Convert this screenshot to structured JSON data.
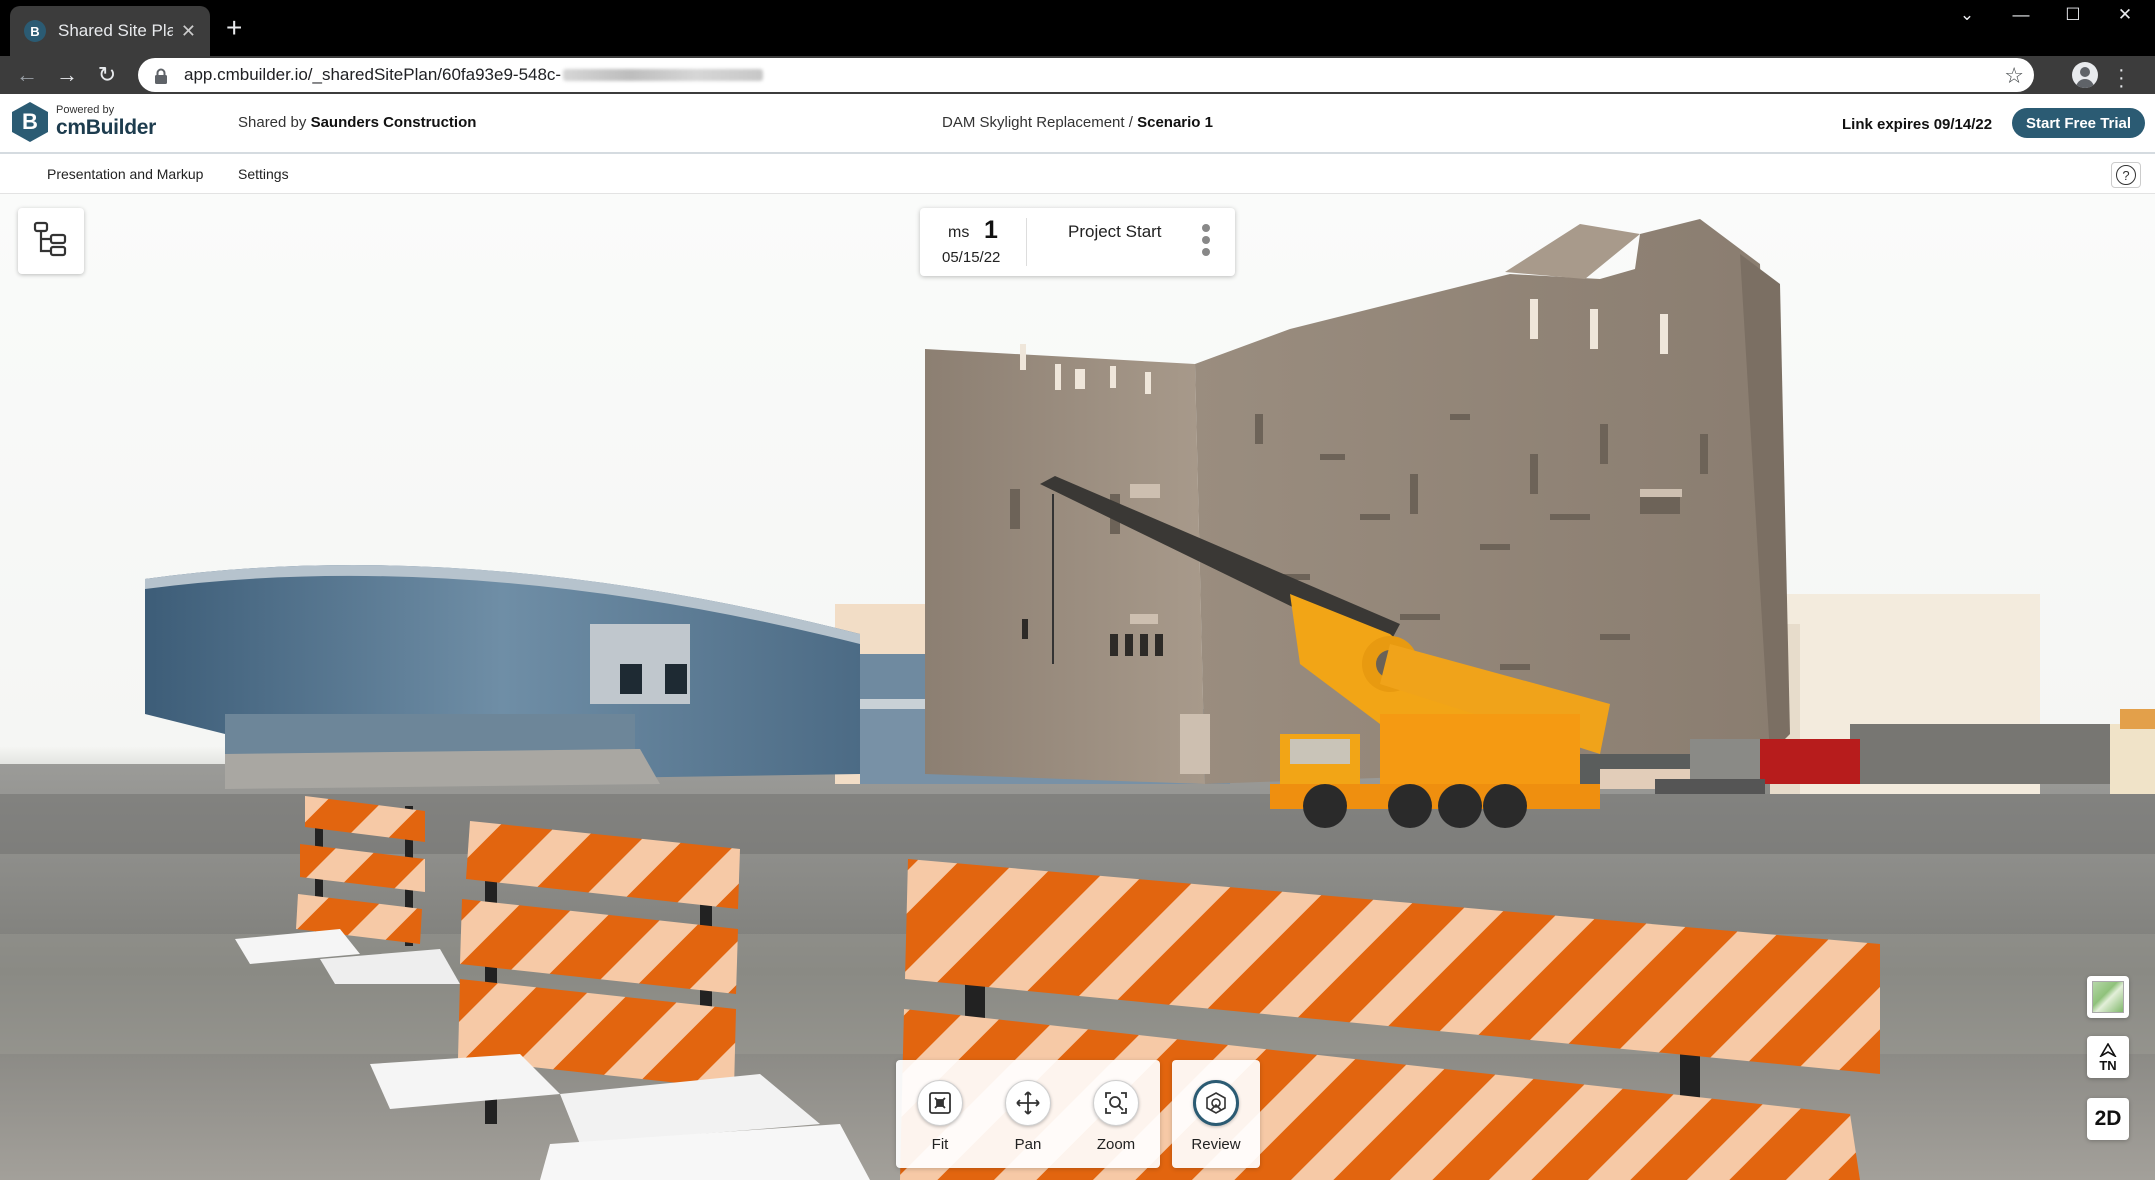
{
  "browser": {
    "tab_title": "Shared Site Plans -",
    "tab_favicon": "B",
    "url": "app.cmbuilder.io/_sharedSitePlan/60fa93e9-548c-"
  },
  "header": {
    "powered_by": "Powered by",
    "brand": "cmBuilder",
    "shared_by_prefix": "Shared by",
    "shared_by_name": "Saunders Construction",
    "project_name": "DAM Skylight Replacement",
    "separator": "/",
    "scenario": "Scenario 1",
    "link_expires": "Link expires 09/14/22",
    "trial_button": "Start Free Trial"
  },
  "subnav": {
    "items": [
      {
        "label": "Presentation and Markup"
      },
      {
        "label": "Settings"
      }
    ],
    "help": "?"
  },
  "milestone": {
    "prefix": "ms",
    "number": "1",
    "date": "05/15/22",
    "title": "Project Start"
  },
  "tools": {
    "fit": "Fit",
    "pan": "Pan",
    "zoom": "Zoom",
    "review": "Review"
  },
  "side_controls": {
    "north_top": "TN",
    "view_mode": "2D"
  },
  "colors": {
    "accent": "#2b5b73",
    "barricade_orange": "#e2650f",
    "barricade_stripe": "#f6c9a6",
    "crane_yellow": "#f2a516"
  },
  "icons": [
    "tree-icon",
    "fit-icon",
    "pan-icon",
    "zoom-icon",
    "review-icon",
    "map-icon",
    "north-arrow-icon",
    "lock-icon",
    "star-icon"
  ]
}
